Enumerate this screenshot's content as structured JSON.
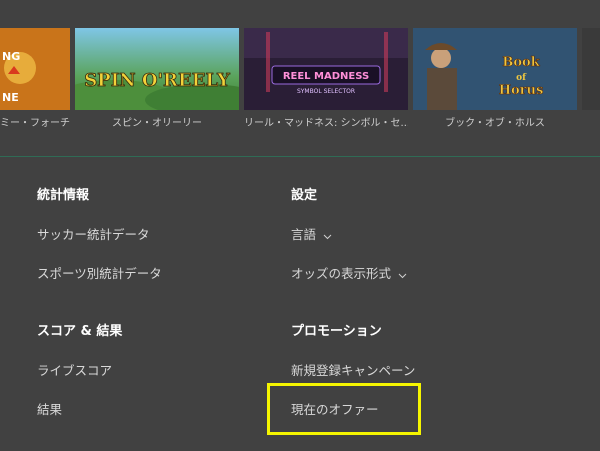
{
  "games": [
    {
      "caption": "ミー・フォーチュン",
      "art_lines": [
        "NG",
        "NE"
      ]
    },
    {
      "caption": "スピン・オリーリー",
      "art_logo": "SPIN O'REELY"
    },
    {
      "caption": "リール・マッドネス: シンボル・セ...",
      "art_logo": "REEL MADNESS",
      "art_sub": "SYMBOL SELECTOR"
    },
    {
      "caption": "ブック・オブ・ホルス",
      "art_logo": [
        "Book",
        "of",
        "Horus"
      ]
    },
    {
      "caption": "",
      "art_logo": ""
    }
  ],
  "footer": {
    "stats": {
      "heading": "統計情報",
      "links": [
        "サッカー統計データ",
        "スポーツ別統計データ"
      ]
    },
    "settings": {
      "heading": "設定",
      "language": "言語",
      "odds_format": "オッズの表示形式"
    },
    "scores": {
      "heading": "スコア & 結果",
      "links": [
        "ライブスコア",
        "結果"
      ]
    },
    "promotions": {
      "heading": "プロモーション",
      "links": [
        "新規登録キャンペーン",
        "現在のオファー"
      ]
    }
  },
  "colors": {
    "background": "#414141",
    "highlight": "#f5f500",
    "divider": "#2f6b55"
  }
}
